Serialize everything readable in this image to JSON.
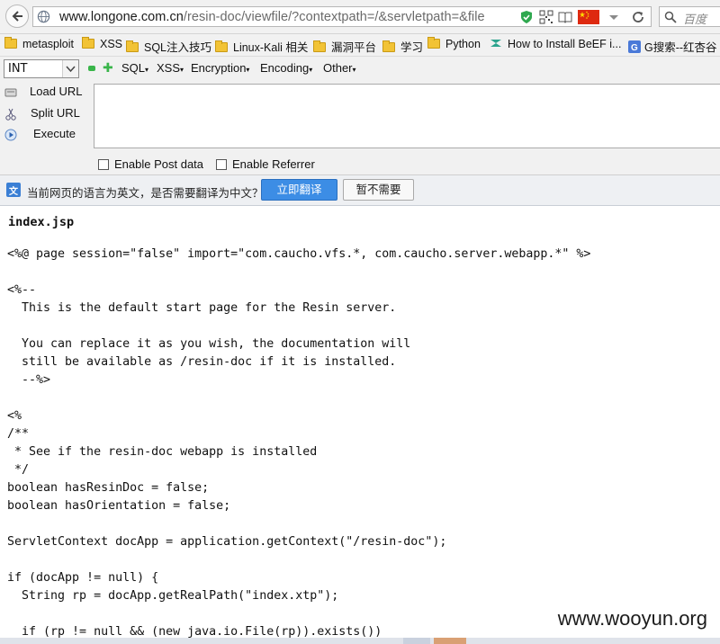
{
  "browser": {
    "url_host": "www.longone.com.cn",
    "url_path": "/resin-doc/viewfile/?contextpath=/&servletpath=&file",
    "search_placeholder": "百度"
  },
  "bookmarks": [
    {
      "label": "metasploit",
      "icon": "folder-icon"
    },
    {
      "label": "XSS",
      "icon": "folder-icon"
    },
    {
      "label": "SQL注入技巧",
      "icon": "folder-icon"
    },
    {
      "label": "Linux-Kali 相关",
      "icon": "folder-icon"
    },
    {
      "label": "漏洞平台",
      "icon": "folder-icon"
    },
    {
      "label": "学习",
      "icon": "folder-icon"
    },
    {
      "label": "Python",
      "icon": "folder-icon"
    },
    {
      "label": "How to Install BeEF i...",
      "icon": "site-icon"
    },
    {
      "label": "G搜索--红杏谷",
      "icon": "google-icon"
    }
  ],
  "hackbar": {
    "type_select": "INT",
    "menus": [
      "SQL",
      "XSS",
      "Encryption",
      "Encoding",
      "Other"
    ],
    "actions": [
      "Load URL",
      "Split URL",
      "Execute"
    ],
    "enable_post": "Enable Post data",
    "enable_referrer": "Enable Referrer"
  },
  "translate": {
    "message": "当前网页的语言为英文，是否需要翻译为中文？",
    "translate_button": "立即翻译",
    "dismiss_button": "暂不需要"
  },
  "content": {
    "title": "index.jsp",
    "code": "<%@ page session=\"false\" import=\"com.caucho.vfs.*, com.caucho.server.webapp.*\" %>\n\n<%--\n  This is the default start page for the Resin server.\n\n  You can replace it as you wish, the documentation will\n  still be available as /resin-doc if it is installed.\n  --%>\n\n<%\n/**\n * See if the resin-doc webapp is installed\n */\nboolean hasResinDoc = false;\nboolean hasOrientation = false;\n\nServletContext docApp = application.getContext(\"/resin-doc\");\n\nif (docApp != null) {\n  String rp = docApp.getRealPath(\"index.xtp\");\n\n  if (rp != null && (new java.io.File(rp)).exists())",
    "watermark": "www.wooyun.org"
  }
}
